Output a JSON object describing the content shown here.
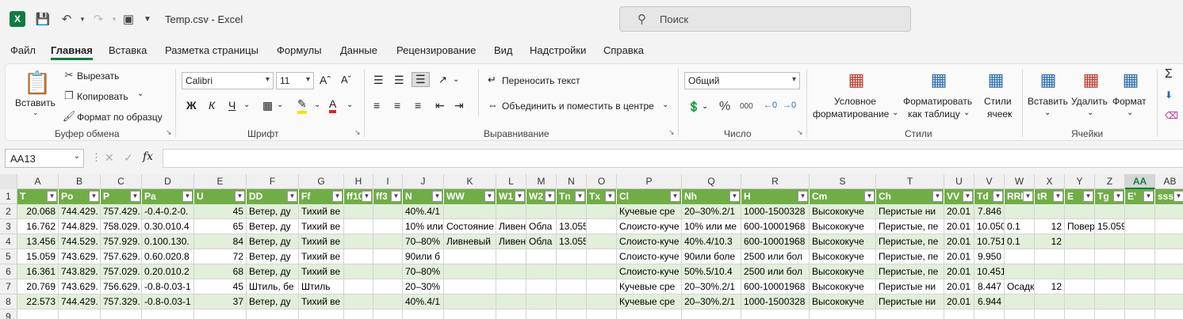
{
  "window": {
    "title": "Temp.csv  -  Excel",
    "search_placeholder": "Поиск"
  },
  "menu": [
    "Файл",
    "Главная",
    "Вставка",
    "Разметка страницы",
    "Формулы",
    "Данные",
    "Рецензирование",
    "Вид",
    "Надстройки",
    "Справка"
  ],
  "ribbon": {
    "clipboard": {
      "paste": "Вставить",
      "cut": "Вырезать",
      "copy": "Копировать",
      "format_painter": "Формат по образцу",
      "label": "Буфер обмена"
    },
    "font": {
      "name": "Calibri",
      "size": "11",
      "label": "Шрифт",
      "bold": "Ж",
      "italic": "К",
      "underline": "Ч"
    },
    "alignment": {
      "wrap": "Переносить текст",
      "merge": "Объединить и поместить в центре",
      "label": "Выравнивание"
    },
    "number": {
      "format": "Общий",
      "label": "Число"
    },
    "styles": {
      "conditional": "Условное",
      "conditional2": "форматирование",
      "as_table": "Форматировать",
      "as_table2": "как таблицу",
      "cell_styles": "Стили",
      "cell_styles2": "ячеек",
      "label": "Стили"
    },
    "cells": {
      "insert": "Вставить",
      "delete": "Удалить",
      "format": "Формат",
      "label": "Ячейки"
    }
  },
  "formula_bar": {
    "name_box": "AA13",
    "fx": "fx"
  },
  "columns": [
    "A",
    "B",
    "C",
    "D",
    "E",
    "F",
    "G",
    "H",
    "I",
    "J",
    "K",
    "L",
    "M",
    "N",
    "O",
    "P",
    "Q",
    "R",
    "S",
    "T",
    "U",
    "V",
    "W",
    "X",
    "Y",
    "Z",
    "AA",
    "AB"
  ],
  "selected_column": "AA",
  "row_numbers": [
    "1",
    "2",
    "3",
    "4",
    "5",
    "6",
    "7",
    "8",
    "9"
  ],
  "header_row": [
    "T",
    "Po",
    "P",
    "Pa",
    "U",
    "DD",
    "Ff",
    "ff10",
    "ff3",
    "N",
    "WW",
    "W1",
    "W2",
    "Tn",
    "Tx",
    "Cl",
    "Nh",
    "H",
    "Cm",
    "Ch",
    "VV",
    "Td",
    "RRR",
    "tR",
    "E",
    "Tg",
    "E'",
    "sss"
  ],
  "rows": [
    [
      "20.068",
      "744.429.",
      "757.429.",
      "-0.4-0.2-0.",
      "45",
      "Ветер, ду",
      "Тихий ве",
      "",
      "",
      "40%.4/1",
      "",
      "",
      "",
      "",
      "",
      "Кучевые сре",
      "20–30%.2/1",
      "1000-1500328",
      "Высококуче",
      "Перистые ни",
      "20.01",
      "7.846",
      "",
      "",
      "",
      "",
      "",
      ""
    ],
    [
      "16.762",
      "744.829.",
      "758.029.",
      "0.30.010.4",
      "65",
      "Ветер, ду",
      "Тихий ве",
      "",
      "",
      "10% или",
      "Состояние",
      "Ливен",
      "Обла",
      "13.055",
      "",
      "Слоисто-куче",
      "10% или ме",
      "600-10001968",
      "Высококуче",
      "Перистые, пе",
      "20.01",
      "10.050",
      "0.1",
      "12",
      "Повер",
      "15.059",
      "",
      ""
    ],
    [
      "13.456",
      "744.529.",
      "757.929.",
      "0.100.130.",
      "84",
      "Ветер, ду",
      "Тихий ве",
      "",
      "",
      "70–80%",
      "Ливневый",
      "Ливен",
      "Обла",
      "13.055",
      "",
      "Слоисто-куче",
      "40%.4/10.3",
      "600-10001968",
      "Высококуче",
      "Перистые, пе",
      "20.01",
      "10.751",
      "0.1",
      "12",
      "",
      "",
      "",
      ""
    ],
    [
      "15.059",
      "743.629.",
      "757.629.",
      "0.60.020.8",
      "72",
      "Ветер, ду",
      "Тихий ве",
      "",
      "",
      "90или б",
      "",
      "",
      "",
      "",
      "",
      "Слоисто-куче",
      "90или боле",
      "2500 или бол",
      "Высококуче",
      "Перистые, пе",
      "20.01",
      "9.950",
      "",
      "",
      "",
      "",
      "",
      ""
    ],
    [
      "16.361",
      "743.829.",
      "757.029.",
      "0.20.010.2",
      "68",
      "Ветер, ду",
      "Тихий ве",
      "",
      "",
      "70–80%",
      "",
      "",
      "",
      "",
      "",
      "Слоисто-куче",
      "50%.5/10.4",
      "2500 или бол",
      "Высококуче",
      "Перистые, пе",
      "20.01",
      "10.451",
      "",
      "",
      "",
      "",
      "",
      ""
    ],
    [
      "20.769",
      "743.629.",
      "756.629.",
      "-0.8-0.03-1",
      "45",
      "Штиль, бе",
      "Штиль",
      "",
      "",
      "20–30%",
      "",
      "",
      "",
      "",
      "",
      "Кучевые сре",
      "20–30%.2/1",
      "600-10001968",
      "Высококуче",
      "Перистые ни",
      "20.01",
      "8.447",
      "Осадк",
      "12",
      "",
      "",
      "",
      ""
    ],
    [
      "22.573",
      "744.429.",
      "757.329.",
      "-0.8-0.03-1",
      "37",
      "Ветер, ду",
      "Тихий ве",
      "",
      "",
      "40%.4/1",
      "",
      "",
      "",
      "",
      "",
      "Кучевые сре",
      "20–30%.2/1",
      "1000-1500328",
      "Высококуче",
      "Перистые ни",
      "20.01",
      "6.944",
      "",
      "",
      "",
      "",
      "",
      ""
    ]
  ],
  "numeric_columns": [
    0,
    4,
    13,
    21,
    23
  ]
}
